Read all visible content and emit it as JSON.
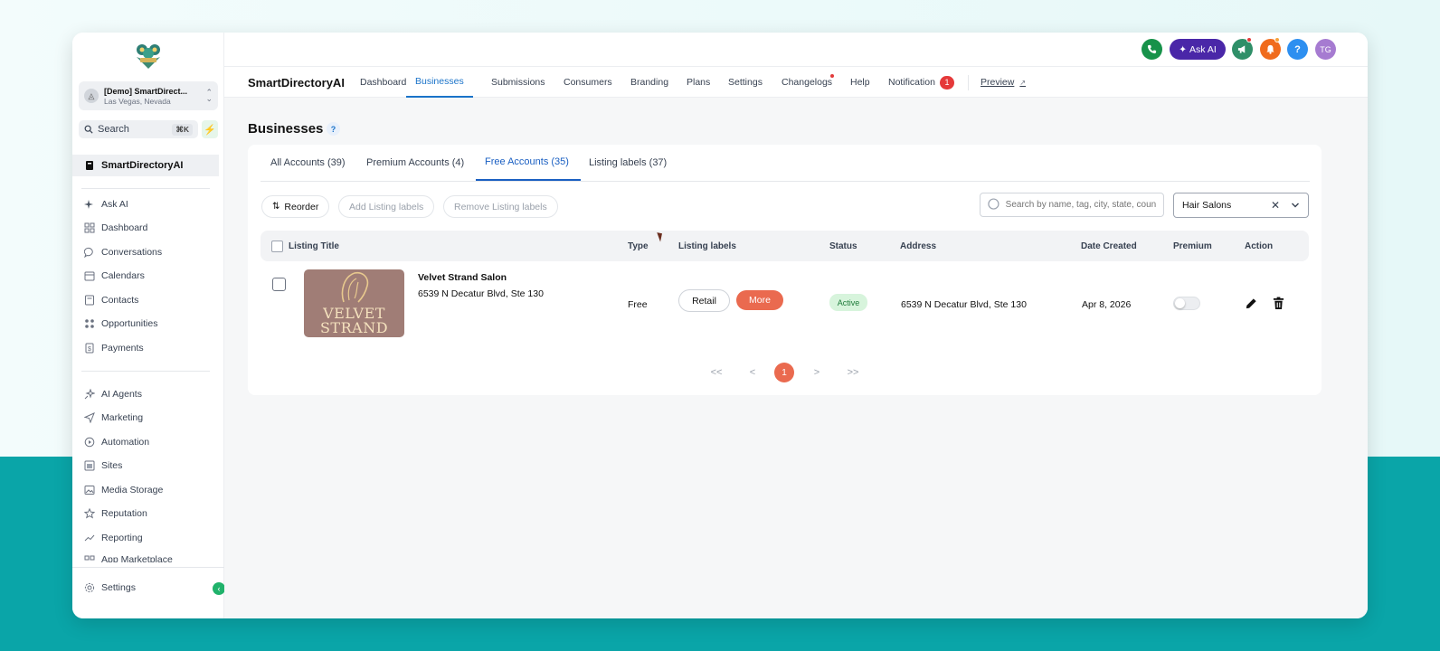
{
  "sidebar": {
    "location": {
      "name": "[Demo] SmartDirect...",
      "sub": "Las Vegas, Nevada"
    },
    "search": {
      "label": "Search",
      "shortcut": "⌘K"
    },
    "active_item": "SmartDirectoryAI",
    "items_group1": [
      {
        "label": "Ask AI",
        "icon": "sparkle-icon"
      },
      {
        "label": "Dashboard",
        "icon": "dashboard-icon"
      },
      {
        "label": "Conversations",
        "icon": "chat-icon"
      },
      {
        "label": "Calendars",
        "icon": "calendar-icon"
      },
      {
        "label": "Contacts",
        "icon": "contacts-icon"
      },
      {
        "label": "Opportunities",
        "icon": "opportunities-icon"
      },
      {
        "label": "Payments",
        "icon": "payments-icon"
      }
    ],
    "items_group2": [
      {
        "label": "AI Agents",
        "icon": "ai-agents-icon"
      },
      {
        "label": "Marketing",
        "icon": "send-icon"
      },
      {
        "label": "Automation",
        "icon": "automation-icon"
      },
      {
        "label": "Sites",
        "icon": "sites-icon"
      },
      {
        "label": "Media Storage",
        "icon": "image-icon"
      },
      {
        "label": "Reputation",
        "icon": "star-icon"
      },
      {
        "label": "Reporting",
        "icon": "trend-icon"
      },
      {
        "label": "App Marketplace",
        "icon": "apps-icon"
      }
    ],
    "settings": "Settings"
  },
  "topbar": {
    "ask_ai": "Ask AI",
    "avatar": "TG",
    "help": "?",
    "colors": {
      "phone": "#17924a",
      "ask_ai": "#4a27a8",
      "megaphone": "#2f8f68",
      "bell": "#f06b1c",
      "help": "#2d8ff0",
      "avatar": "#a67bd1"
    }
  },
  "subnav": {
    "brand": "SmartDirectoryAI",
    "items": [
      "Dashboard",
      "Businesses",
      "Submissions",
      "Consumers",
      "Branding",
      "Plans",
      "Settings",
      "Changelogs",
      "Help",
      "Notification"
    ],
    "active": "Businesses",
    "notification_count": "1",
    "preview": "Preview"
  },
  "page": {
    "title": "Businesses",
    "help": "?",
    "tabs": [
      "All Accounts (39)",
      "Premium Accounts (4)",
      "Free Accounts (35)",
      "Listing labels (37)"
    ],
    "active_tab": "Free Accounts (35)",
    "toolbar": {
      "reorder": "Reorder",
      "add_labels": "Add Listing labels",
      "remove_labels": "Remove Listing labels"
    },
    "search_placeholder": "Search by name, tag, city, state, country",
    "filter_value": "Hair Salons",
    "columns": [
      "Listing Title",
      "Type",
      "Listing labels",
      "Status",
      "Address",
      "Date Created",
      "Premium",
      "Action"
    ],
    "rows": [
      {
        "title": "Velvet Strand Salon",
        "subtitle": "6539 N Decatur Blvd, Ste 130",
        "thumb_text": [
          "VELVET",
          "STRAND"
        ],
        "type": "Free",
        "label": "Retail",
        "more": "More",
        "status": "Active",
        "address": "6539 N Decatur Blvd, Ste 130",
        "date": "Apr 8, 2026",
        "premium": false
      }
    ],
    "pagination": {
      "first": "<<",
      "prev": "<",
      "current": "1",
      "next": ">",
      "last": ">>"
    }
  }
}
